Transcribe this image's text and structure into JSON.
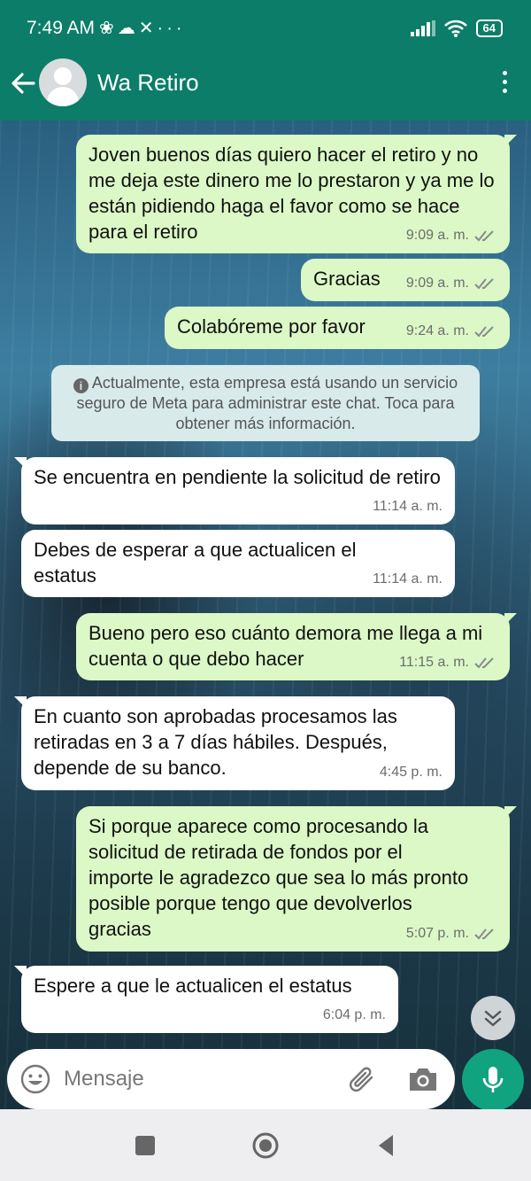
{
  "status_bar": {
    "time": "7:49 AM",
    "icons": [
      "fan-icon",
      "cloud-icon",
      "x-icon",
      "more-dots-icon"
    ],
    "signal": "signal-icon",
    "wifi": "wifi-icon",
    "battery": "64"
  },
  "header": {
    "contact_name": "Wa Retiro"
  },
  "messages": [
    {
      "dir": "out",
      "text": "Joven buenos días quiero hacer el retiro y no me deja este dinero me lo prestaron y ya me lo están pidiendo haga el favor como se hace para el retiro",
      "time": "9:09 a. m."
    },
    {
      "dir": "out",
      "text": "Gracias",
      "time": "9:09 a. m."
    },
    {
      "dir": "out",
      "text": "Colabóreme por favor",
      "time": "9:24 a. m."
    },
    {
      "dir": "in",
      "text": "Se encuentra en pendiente la solicitud de retiro",
      "time": "11:14 a. m."
    },
    {
      "dir": "in",
      "text": "Debes de esperar a que actualicen el estatus",
      "time": "11:14 a. m."
    },
    {
      "dir": "out",
      "text": "Bueno pero eso cuánto demora me llega a mi cuenta o que debo hacer",
      "time": "11:15 a. m."
    },
    {
      "dir": "in",
      "text": "En cuanto son aprobadas procesamos las retiradas en 3 a 7 días hábiles. Después, depende de su banco.",
      "time": "4:45 p. m."
    },
    {
      "dir": "out",
      "text": "Si porque aparece como procesando la solicitud de retirada de fondos por el importe le agradezco que sea lo más pronto posible porque tengo que devolverlos gracias",
      "time": "5:07 p. m."
    },
    {
      "dir": "in",
      "text": "Espere a que le actualicen el estatus",
      "time": "6:04 p. m."
    }
  ],
  "notice": {
    "text": "Actualmente, esta empresa está usando un servicio seguro de Meta para administrar este chat. Toca para obtener más información."
  },
  "composer": {
    "placeholder": "Mensaje"
  },
  "colors": {
    "header": "#0b7d68",
    "outgoing_bubble": "#dbf8c6",
    "incoming_bubble": "#ffffff",
    "mic_button": "#11a37f"
  }
}
